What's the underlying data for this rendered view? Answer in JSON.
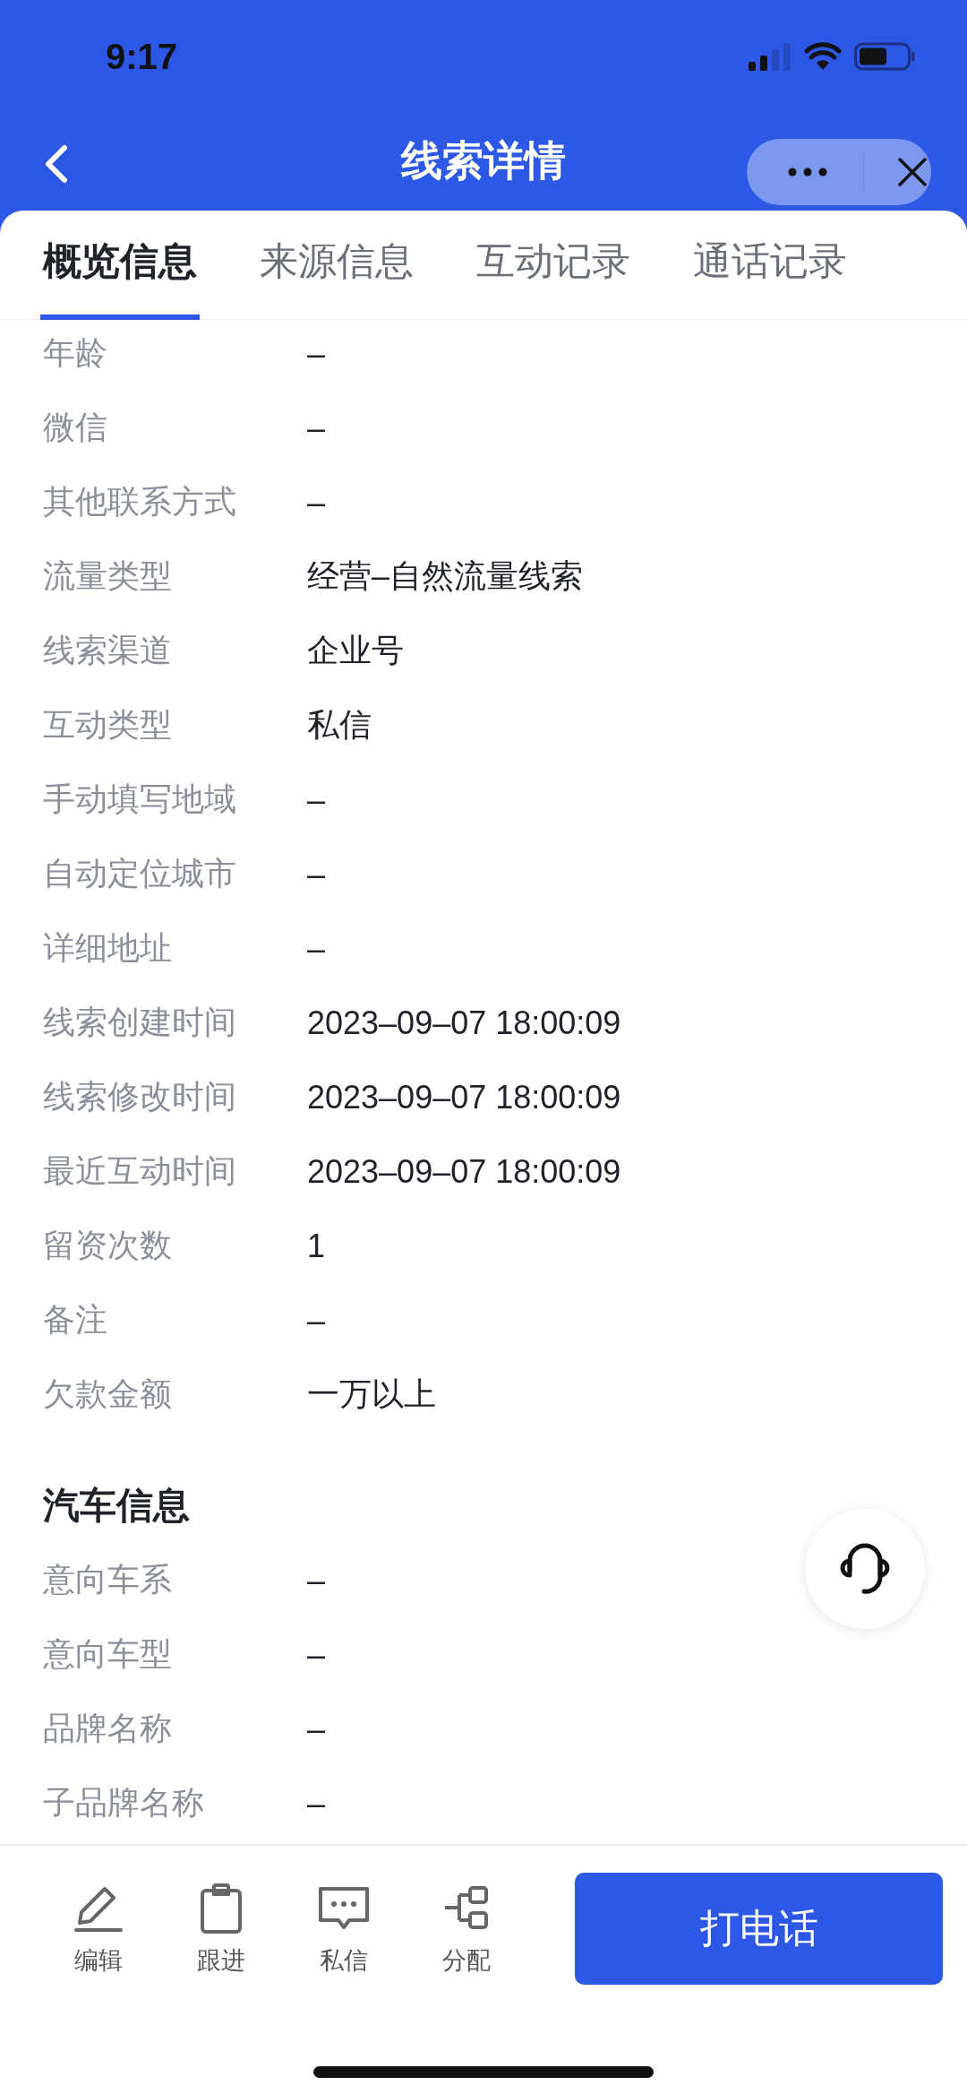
{
  "status_bar": {
    "time": "9:17"
  },
  "nav": {
    "title": "线索详情"
  },
  "tabs": [
    {
      "label": "概览信息",
      "selected": true
    },
    {
      "label": "来源信息",
      "selected": false
    },
    {
      "label": "互动记录",
      "selected": false
    },
    {
      "label": "通话记录",
      "selected": false
    }
  ],
  "sections": [
    {
      "rows": [
        {
          "label": "年龄",
          "value": "–"
        },
        {
          "label": "微信",
          "value": "–"
        },
        {
          "label": "其他联系方式",
          "value": "–"
        },
        {
          "label": "流量类型",
          "value": "经营–自然流量线索"
        },
        {
          "label": "线索渠道",
          "value": "企业号"
        },
        {
          "label": "互动类型",
          "value": "私信"
        },
        {
          "label": "手动填写地域",
          "value": "–"
        },
        {
          "label": "自动定位城市",
          "value": "–"
        },
        {
          "label": "详细地址",
          "value": "–"
        },
        {
          "label": "线索创建时间",
          "value": "2023–09–07 18:00:09"
        },
        {
          "label": "线索修改时间",
          "value": "2023–09–07 18:00:09"
        },
        {
          "label": "最近互动时间",
          "value": "2023–09–07 18:00:09"
        },
        {
          "label": "留资次数",
          "value": "1"
        },
        {
          "label": "备注",
          "value": "–"
        },
        {
          "label": "欠款金额",
          "value": "一万以上"
        }
      ]
    },
    {
      "title": "汽车信息",
      "rows": [
        {
          "label": "意向车系",
          "value": "–"
        },
        {
          "label": "意向车型",
          "value": "–"
        },
        {
          "label": "品牌名称",
          "value": "–"
        },
        {
          "label": "子品牌名称",
          "value": "–"
        }
      ]
    }
  ],
  "actions": [
    {
      "kind": "edit",
      "label": "编辑"
    },
    {
      "kind": "follow",
      "label": "跟进"
    },
    {
      "kind": "message",
      "label": "私信"
    },
    {
      "kind": "assign",
      "label": "分配"
    }
  ],
  "call_button": {
    "label": "打电话"
  }
}
